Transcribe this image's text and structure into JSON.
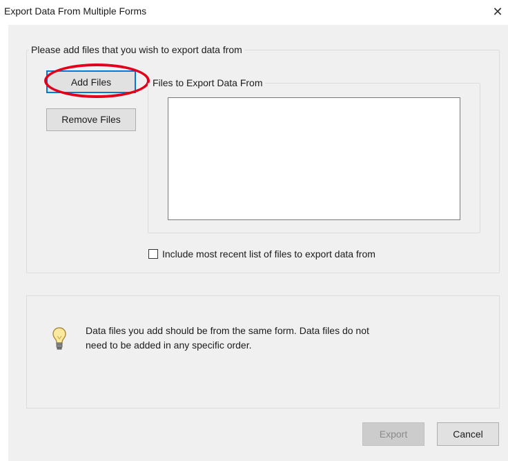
{
  "window": {
    "title": "Export Data From Multiple Forms",
    "close_icon": "close-icon",
    "close_glyph": "✕"
  },
  "add_group": {
    "legend": "Please add files that you wish to export data from",
    "add_button": "Add Files",
    "remove_button": "Remove Files",
    "files_group": {
      "legend": "Files to Export Data From",
      "items": []
    },
    "checkbox": {
      "label": "Include most recent list of files to export data from",
      "checked": false
    }
  },
  "info": {
    "icon": "lightbulb-icon",
    "text_line1": "Data files you add should be from the same form. Data files do not",
    "text_line2": "need to be added in any specific order."
  },
  "footer": {
    "export_button": "Export",
    "export_enabled": false,
    "cancel_button": "Cancel"
  },
  "annotation": {
    "highlight_color": "#e2001a",
    "focus_color": "#0078d7"
  }
}
